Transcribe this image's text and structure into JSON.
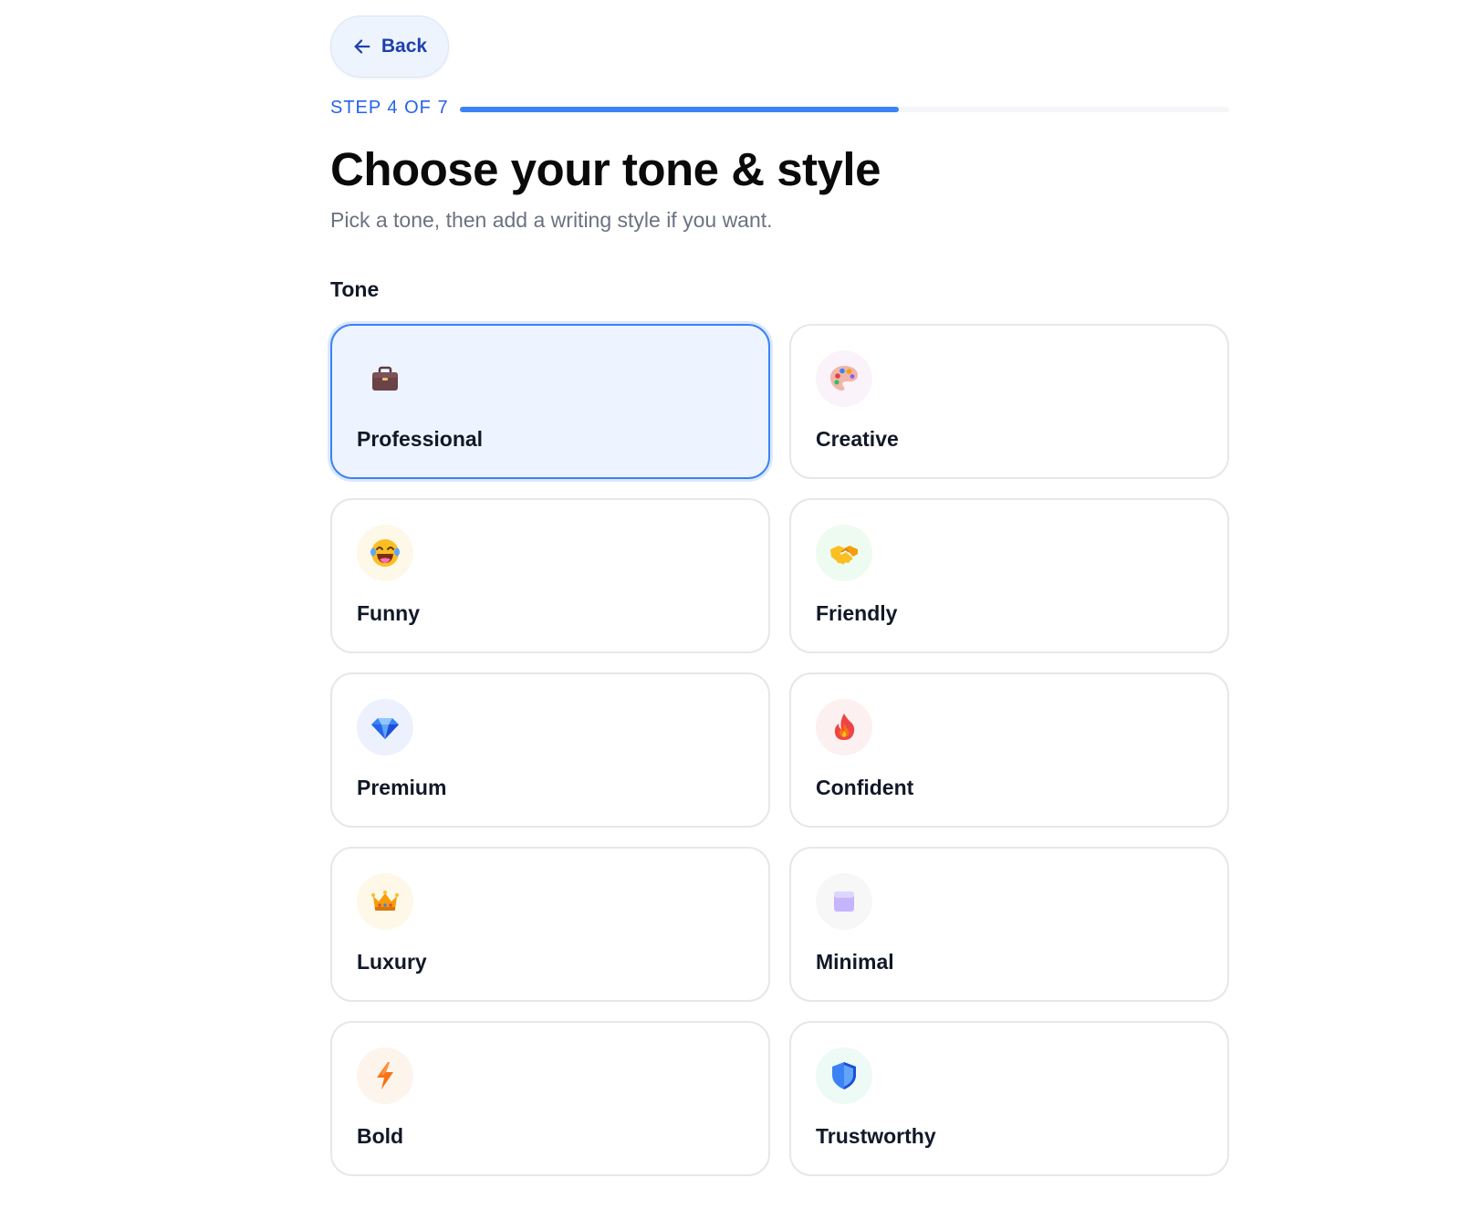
{
  "back": {
    "label": "Back"
  },
  "progress": {
    "label": "STEP 4 OF 7",
    "current": 4,
    "total": 7,
    "fraction": 0.571
  },
  "title": "Choose your tone & style",
  "subtitle": "Pick a tone, then add a writing style if you want.",
  "tone_section": {
    "label": "Tone"
  },
  "tones": [
    {
      "label": "Professional",
      "icon": "briefcase-icon",
      "selected": true,
      "bubble_color": "#edf4ff"
    },
    {
      "label": "Creative",
      "icon": "palette-icon",
      "selected": false,
      "bubble_color": "#fbf3fa"
    },
    {
      "label": "Funny",
      "icon": "laughing-face-icon",
      "selected": false,
      "bubble_color": "#fdf8e8"
    },
    {
      "label": "Friendly",
      "icon": "handshake-icon",
      "selected": false,
      "bubble_color": "#eefbf1"
    },
    {
      "label": "Premium",
      "icon": "diamond-icon",
      "selected": false,
      "bubble_color": "#edf1fd"
    },
    {
      "label": "Confident",
      "icon": "fire-icon",
      "selected": false,
      "bubble_color": "#fdf0f0"
    },
    {
      "label": "Luxury",
      "icon": "crown-icon",
      "selected": false,
      "bubble_color": "#fdf8e8"
    },
    {
      "label": "Minimal",
      "icon": "square-icon",
      "selected": false,
      "bubble_color": "#f7f7f8"
    },
    {
      "label": "Bold",
      "icon": "lightning-icon",
      "selected": false,
      "bubble_color": "#fdf4ec"
    },
    {
      "label": "Trustworthy",
      "icon": "shield-icon",
      "selected": false,
      "bubble_color": "#edfaf6"
    }
  ],
  "colors": {
    "accent": "#3b82f6",
    "accent_dark": "#1e40af",
    "selected_bg": "#edf4ff",
    "card_border": "#e5e7eb"
  }
}
